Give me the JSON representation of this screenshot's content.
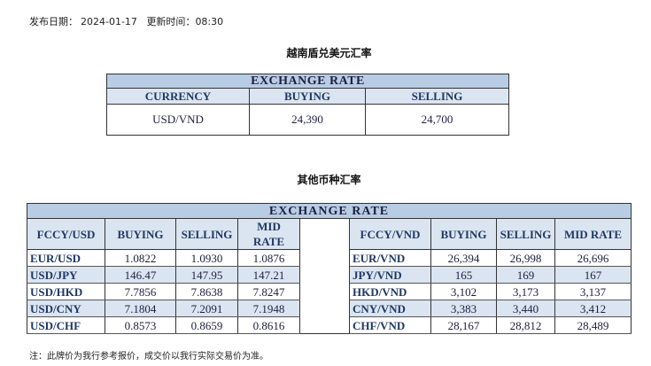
{
  "publish": {
    "date_label": "发布日期：",
    "date": "2024-01-17",
    "time_label": "更新时间：",
    "time": "08:30"
  },
  "usd_vnd": {
    "title": "越南盾兑美元汇率",
    "header": "EXCHANGE RATE",
    "columns": [
      "CURRENCY",
      "BUYING",
      "SELLING"
    ],
    "row": [
      "USD/VND",
      "24,390",
      "24,700"
    ]
  },
  "other": {
    "title": "其他币种汇率",
    "header": "EXCHANGE  RATE",
    "left_columns": [
      "FCCY/USD",
      "BUYING",
      "SELLING",
      "MID RATE"
    ],
    "right_columns": [
      "FCCY/VND",
      "BUYING",
      "SELLING",
      "MID RATE"
    ],
    "rows": [
      {
        "l": [
          "EUR/USD",
          "1.0822",
          "1.0930",
          "1.0876"
        ],
        "r": [
          "EUR/VND",
          "26,394",
          "26,998",
          "26,696"
        ]
      },
      {
        "l": [
          "USD/JPY",
          "146.47",
          "147.95",
          "147.21"
        ],
        "r": [
          "JPY/VND",
          "165",
          "169",
          "167"
        ]
      },
      {
        "l": [
          "USD/HKD",
          "7.7856",
          "7.8638",
          "7.8247"
        ],
        "r": [
          "HKD/VND",
          "3,102",
          "3,173",
          "3,137"
        ]
      },
      {
        "l": [
          "USD/CNY",
          "7.1804",
          "7.2091",
          "7.1948"
        ],
        "r": [
          "CNY/VND",
          "3,383",
          "3,440",
          "3,412"
        ]
      },
      {
        "l": [
          "USD/CHF",
          "0.8573",
          "0.8659",
          "0.8616"
        ],
        "r": [
          "CHF/VND",
          "28,167",
          "28,812",
          "28,489"
        ]
      }
    ]
  },
  "note": "注：此牌价为我行参考报价，成交价以我行实际交易价为准。",
  "colors": {
    "header_bg": "#b8cce4",
    "subheader_bg": "#dbe5f1",
    "label_text": "#1f3864"
  }
}
